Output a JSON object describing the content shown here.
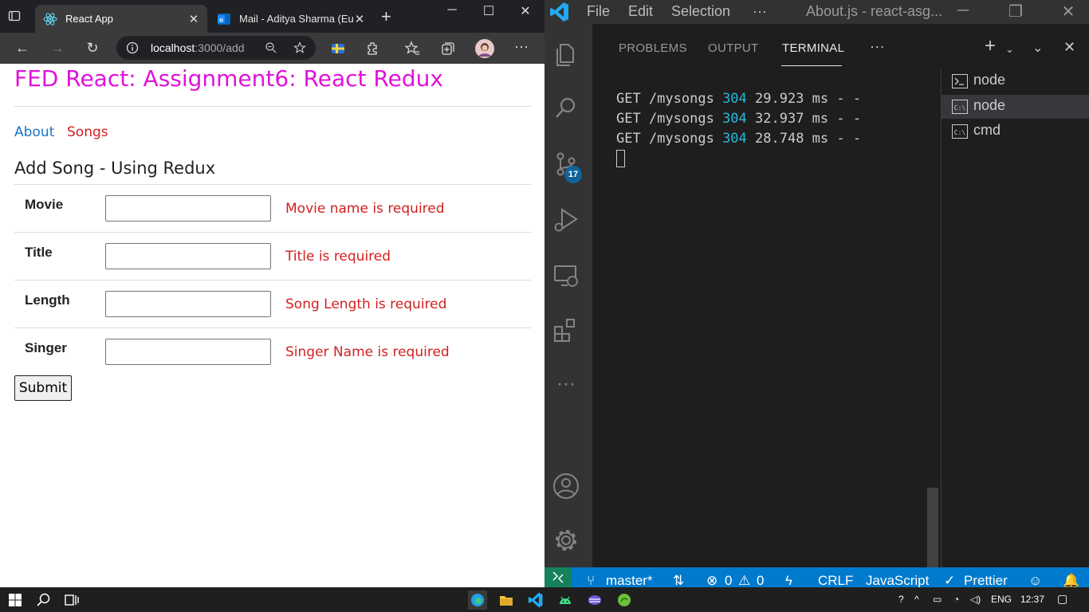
{
  "browser": {
    "tabs": [
      {
        "title": "React App",
        "active": true
      },
      {
        "title": "Mail - Aditya Sharma (Europ",
        "active": false
      }
    ],
    "address": {
      "host": "localhost",
      "path": ":3000/add"
    }
  },
  "page": {
    "title": "FED React: Assignment6: React Redux",
    "nav": [
      {
        "label": "About",
        "color": "#1a73c8"
      },
      {
        "label": "Songs",
        "color": "#d21f1f"
      }
    ],
    "form_heading": "Add Song - Using Redux",
    "fields": [
      {
        "label": "Movie",
        "value": "",
        "error": "Movie name is required"
      },
      {
        "label": "Title",
        "value": "",
        "error": "Title is required"
      },
      {
        "label": "Length",
        "value": "",
        "error": "Song Length is required"
      },
      {
        "label": "Singer",
        "value": "",
        "error": "Singer Name is required"
      }
    ],
    "submit_label": "Submit"
  },
  "vscode": {
    "menu": [
      "File",
      "Edit",
      "Selection",
      "···"
    ],
    "window_title": "About.js - react-asg...",
    "source_control_badge": "17",
    "panel_tabs": [
      "PROBLEMS",
      "OUTPUT",
      "TERMINAL",
      "···"
    ],
    "active_panel_tab": "TERMINAL",
    "terminal_lines": [
      {
        "pre": "GET /mysongs ",
        "code": "304",
        "post": " 29.923 ms - -"
      },
      {
        "pre": "GET /mysongs ",
        "code": "304",
        "post": " 32.937 ms - -"
      },
      {
        "pre": "GET /mysongs ",
        "code": "304",
        "post": " 28.748 ms - -"
      }
    ],
    "terminals": [
      {
        "name": "node",
        "selected": false
      },
      {
        "name": "node",
        "selected": true
      },
      {
        "name": "cmd",
        "selected": false
      }
    ],
    "status": {
      "branch": "master*",
      "errors": "0",
      "warnings": "0",
      "eol": "CRLF",
      "language": "JavaScript",
      "formatter": "Prettier"
    }
  },
  "taskbar": {
    "language": "ENG",
    "time": "12:37"
  },
  "colors": {
    "title_magenta": "#e012d9",
    "error_red": "#d21f1f",
    "link_blue": "#1a73c8",
    "vscode_status_blue": "#007acc",
    "terminal_code_cyan": "#29b8db"
  }
}
